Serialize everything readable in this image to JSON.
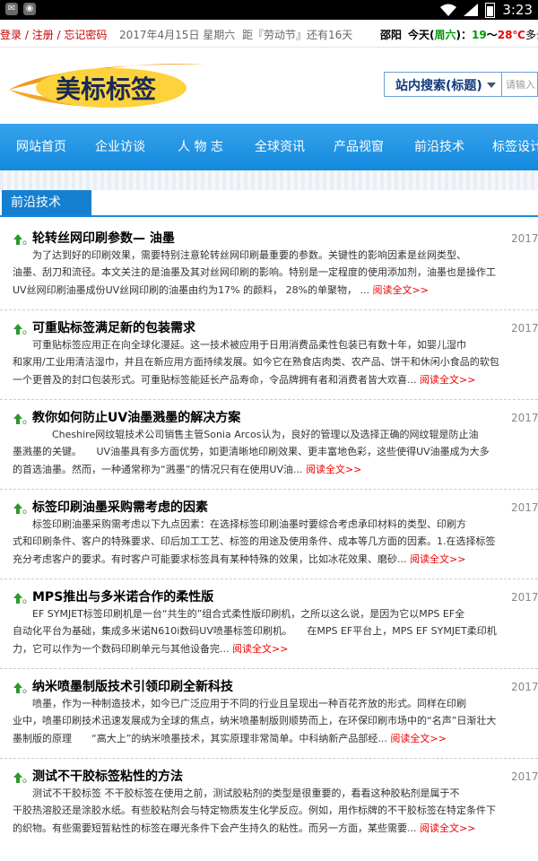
{
  "status_bar": {
    "time": "3:23"
  },
  "topbar": {
    "login": "登录",
    "register": "注册",
    "forgot": "忘记密码",
    "date": "2017年4月15日 星期六",
    "countdown": "距『劳动节』还有16天",
    "city": "邵阳",
    "today_prefix": "今天(",
    "weekday": "周六",
    "today_suffix": ")：",
    "low": "19",
    "temp_sep": "～",
    "high": "28℃",
    "sky": "多云"
  },
  "header": {
    "logo_text": "美标标签",
    "search_scope": "站内搜索(标题)",
    "search_placeholder": "请输入"
  },
  "nav": {
    "items": [
      "网站首页",
      "企业访谈",
      "人 物 志",
      "全球资讯",
      "产品视窗",
      "前沿技术",
      "标签设计"
    ]
  },
  "section": {
    "title": "前沿技术"
  },
  "articles": [
    {
      "title": "轮转丝网印刷参数— 油墨",
      "date": "2017-",
      "line1": "　　为了达到好的印刷效果，需要特别注意轮转丝网印刷最重要的参数。关键性的影响因素是丝网类型、",
      "line2": "油墨、刮刀和流径。本文关注的是油墨及其对丝网印刷的影响。特别是一定程度的使用添加剂，油墨也是操作工",
      "line3": "UV丝网印刷油墨成份UV丝网印刷的油墨由约为17% 的颜料， 28%的单聚物， ... ",
      "more": "阅读全文>>"
    },
    {
      "title": "可重贴标签满足新的包装需求",
      "date": "2017-",
      "line1": "　　可重贴标签应用正在向全球化漫延。这一技术被应用于日用消费品柔性包装已有数十年，如婴儿湿巾",
      "line2": "和家用/工业用清洁湿巾，并且在新应用方面持续发展。如今它在熟食店肉类、农产品、饼干和休闲小食品的软包",
      "line3": "一个更普及的封口包装形式。可重贴标签能延长产品寿命，令品牌拥有者和消费者皆大欢喜... ",
      "more": "阅读全文>>"
    },
    {
      "title": "教你如何防止UV油墨溅墨的解决方案",
      "date": "2017-",
      "line1": "　　　　Cheshire网纹辊技术公司销售主管Sonia Arcos认为，良好的管理以及选择正确的网纹辊是防止油",
      "line2": "墨溅墨的关键。　　UV油墨具有多方面优势，如更清晰地印刷效果、更丰富地色彩，这些使得UV油墨成为大多",
      "line3": "的首选油墨。然而，一种通常称为“溅墨”的情况只有在使用UV油... ",
      "more": "阅读全文>>"
    },
    {
      "title": "标签印刷油墨采购需考虑的因素",
      "date": "2017-",
      "line1": "　　标签印刷油墨采购需考虑以下九点因素：在选择标签印刷油墨时要综合考虑承印材料的类型、印刷方",
      "line2": "式和印刷条件、客户的特殊要求、印后加工工艺、标签的用途及使用条件、成本等几方面的因素。1.在选择标签",
      "line3": "充分考虑客户的要求。有时客户可能要求标签具有某种特殊的效果，比如冰花效果、磨砂... ",
      "more": "阅读全文>>"
    },
    {
      "title": "MPS推出与多米诺合作的柔性版",
      "date": "2017-",
      "line1": "　　EF SYMJET标签印刷机是一台“共生的”组合式柔性版印刷机，之所以这么说，是因为它以MPS EF全",
      "line2": "自动化平台为基础，集成多米诺N610i数码UV喷墨标签印刷机。　　在MPS EF平台上，MPS EF SYMJET柔印机",
      "line3": "力，它可以作为一个数码印刷单元与其他设备完... ",
      "more": "阅读全文>>"
    },
    {
      "title": "纳米喷墨制版技术引领印刷全新科技",
      "date": "2017-",
      "line1": "　　喷墨，作为一种制造技术，如今已广泛应用于不同的行业且呈现出一种百花齐放的形式。同样在印刷",
      "line2": "业中，喷墨印刷技术迅速发展成为全球的焦点，纳米喷墨制版则顺势而上，在环保印刷市场中的“名声”日渐壮大",
      "line3": "墨制版的原理　　“高大上”的纳米喷墨技术，其实原理非常简单。中科纳新产品部经... ",
      "more": "阅读全文>>"
    },
    {
      "title": "测试不干胶标签粘性的方法",
      "date": "2017-",
      "line1": "　　测试不干胶标签 不干胶标签在使用之前，测试胶粘剂的类型是很重要的，看看这种胶粘剂是属于不",
      "line2": "干胶热溶胶还是涂胶水纸。有些胶粘剂会与特定物质发生化学反应。例如，用作标牌的不干胶标签在特定条件下",
      "line3": "的织物。有些需要短暂粘性的标签在曝光条件下会产生持久的粘性。而另一方面，某些需要... ",
      "more": "阅读全文>>"
    }
  ]
}
